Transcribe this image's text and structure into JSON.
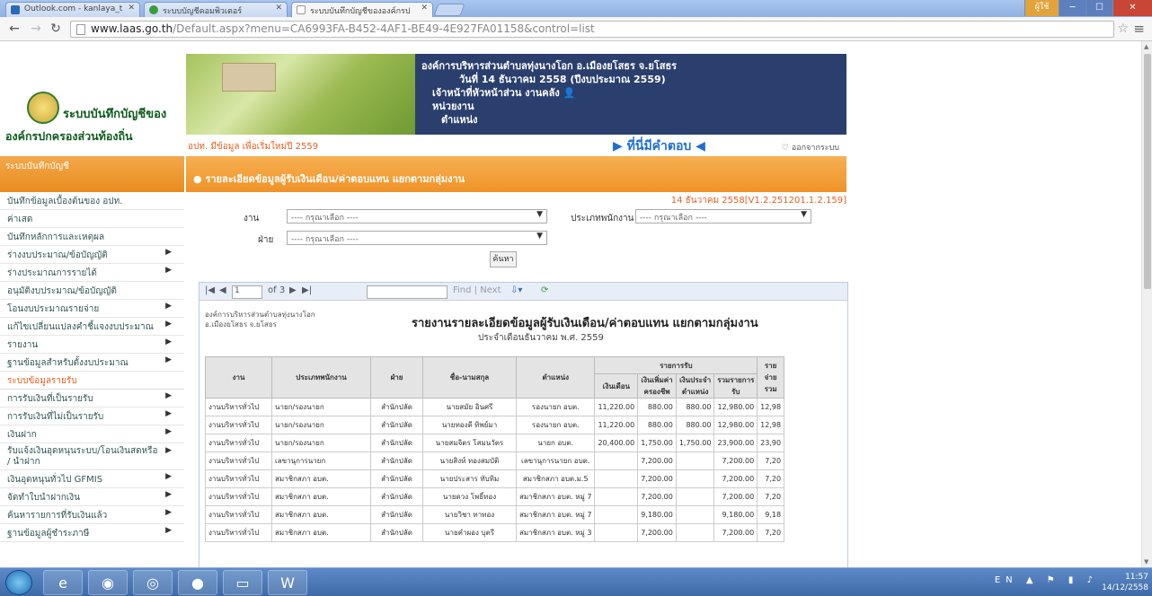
{
  "browser": {
    "tabs": [
      {
        "label": "Outlook.com - kanlaya_t",
        "favicon_color": "#2a6ab8"
      },
      {
        "label": "ระบบบัญชีคอมพิวเตอร์",
        "favicon_color": "#3c9c3c"
      },
      {
        "label": "ระบบบันทึกบัญชีขององค์กรป",
        "favicon_color": "#cccccc"
      }
    ],
    "url_domain": "www.laas.go.th",
    "url_path": "/Default.aspx?menu=CA6993FA-B452-4AF1-BE49-4E927FA01158&control=list",
    "user_button": "ผู้ใช้",
    "minimize": "─",
    "maximize": "☐",
    "close": "✕"
  },
  "site": {
    "logo_line1": "ระบบบันทึกบัญชีของ",
    "logo_line2": "องค์กรปกครองส่วนท้องถิ่น",
    "banner_lines": [
      "องค์การบริหารส่วนตำบลทุ่งนางโอก อ.เมืองยโสธร จ.ยโสธร",
      "วันที่ 14 ธันวาคม 2558 (ปีงบประมาณ 2559)",
      "เจ้าหน้าที่หัวหน้าส่วน งานคลัง",
      "หน่วยงาน",
      "ตำแหน่ง"
    ],
    "subline_left": "อปท. มีข้อมูล เพื่อเริ่มใหม่ปี 2559",
    "subline_center": "▶ ที่นี่มีคำตอบ ◀",
    "logout": "ออกจากระบบ"
  },
  "sidebar": {
    "header": "ระบบบันทึกบัญชี",
    "items": [
      {
        "label": "บันทึกข้อมูลเบื้องต้นของ อปท.",
        "arrow": ""
      },
      {
        "label": "ค่าเสด",
        "arrow": ""
      },
      {
        "label": "บันทึกหลักการและเหตุผล",
        "arrow": ""
      },
      {
        "label": "ร่างงบประมาณ/ข้อบัญญัติ",
        "arrow": "▶"
      },
      {
        "label": "ร่างประมาณการรายได้",
        "arrow": "▶"
      },
      {
        "label": "อนุมัติงบประมาณ/ข้อบัญญัติ",
        "arrow": ""
      },
      {
        "label": "โอนงบประมาณรายจ่าย",
        "arrow": "▶"
      },
      {
        "label": "แก้ไขเปลี่ยนแปลงคำชี้แจงงบประมาณ",
        "arrow": "▶"
      },
      {
        "label": "รายงาน",
        "arrow": "▶"
      },
      {
        "label": "ฐานข้อมูลสำหรับตั้งงบประมาณ",
        "arrow": "▶"
      }
    ],
    "section": "ระบบข้อมูลรายรับ",
    "items2": [
      {
        "label": "การรับเงินที่เป็นรายรับ",
        "arrow": "▶"
      },
      {
        "label": "การรับเงินที่ไม่เป็นรายรับ",
        "arrow": "▶"
      },
      {
        "label": "เงินฝาก",
        "arrow": "▶"
      },
      {
        "label": "รับแจ้งเงินอุดหนุนระบบ/โอนเงินสดหรือ / นำฝาก",
        "arrow": "▶"
      },
      {
        "label": "เงินอุดหนุนทั่วไป GFMIS",
        "arrow": "▶"
      },
      {
        "label": "จัดทำใบนำฝากเงิน",
        "arrow": "▶"
      },
      {
        "label": "ค้นหารายการที่รับเงินแล้ว",
        "arrow": "▶"
      },
      {
        "label": "ฐานข้อมูลผู้ชำระภาษี",
        "arrow": "▶"
      }
    ]
  },
  "content": {
    "header": "รายละเอียดข้อมูลผู้รับเงินเดือน/ค่าตอบแทน แยกตามกลุ่มงาน",
    "version": "14 ธันวาคม 2558[V1.2.251201.1.2.159]",
    "filter_job_label": "งาน",
    "filter_job_value": "---- กรุณาเลือก ----",
    "filter_type_label": "ประเภทพนักงาน",
    "filter_type_value": "---- กรุณาเลือก ----",
    "filter_div_label": "ฝ่าย",
    "filter_div_value": "---- กรุณาเลือก ----",
    "search_btn": "ค้นหา"
  },
  "report": {
    "page_current": "1",
    "page_total": "of 3",
    "find_label": "Find | Next",
    "org": [
      "องค์การบริหารส่วนตำบลทุ่งนางโอก",
      "อ.เมืองยโสธร จ.ยโสธร"
    ],
    "title": "รายงานรายละเอียดข้อมูลผู้รับเงินเดือน/ค่าตอบแทน แยกตามกลุ่มงาน",
    "subtitle": "ประจำเดือนธันวาคม พ.ศ. 2559",
    "columns": [
      "งาน",
      "ประเภทพนักงาน",
      "ฝ่าย",
      "ชื่อ-นามสกุล",
      "ตำแหน่ง"
    ],
    "income_group": "รายการรับ",
    "income_cols": [
      "เงินเดือน",
      "เงินเพิ่มค่าครองชีพ",
      "เงินประจำตำแหน่ง",
      "รวมรายการรับ"
    ],
    "last_col": "รายจ่ายรวม",
    "rows": [
      {
        "job": "งานบริหารทั่วไป",
        "type": "นายก/รองนายก",
        "div": "สำนักปลัด",
        "name": "นายสมัย อินศรี",
        "pos": "รองนายก อบต.",
        "c1": "11,220.00",
        "c2": "880.00",
        "c3": "880.00",
        "c4": "12,980.00",
        "c5": "12,98"
      },
      {
        "job": "งานบริหารทั่วไป",
        "type": "นายก/รองนายก",
        "div": "สำนักปลัด",
        "name": "นายทองดี ทิพย์มา",
        "pos": "รองนายก อบต.",
        "c1": "11,220.00",
        "c2": "880.00",
        "c3": "880.00",
        "c4": "12,980.00",
        "c5": "12,98"
      },
      {
        "job": "งานบริหารทั่วไป",
        "type": "นายก/รองนายก",
        "div": "สำนักปลัด",
        "name": "นายสมจิตร โสมนวัตร",
        "pos": "นายก อบต.",
        "c1": "20,400.00",
        "c2": "1,750.00",
        "c3": "1,750.00",
        "c4": "23,900.00",
        "c5": "23,90"
      },
      {
        "job": "งานบริหารทั่วไป",
        "type": "เลขานุการนายก",
        "div": "สำนักปลัด",
        "name": "นายสิงห์ ทองสมบัติ",
        "pos": "เลขานุการนายก อบต.",
        "c1": "",
        "c2": "7,200.00",
        "c3": "",
        "c4": "7,200.00",
        "c5": "7,20"
      },
      {
        "job": "งานบริหารทั่วไป",
        "type": "สมาชิกสภา อบต.",
        "div": "สำนักปลัด",
        "name": "นายประสาร ทับทิม",
        "pos": "สมาชิกสภา อบต.ม.5",
        "c1": "",
        "c2": "7,200.00",
        "c3": "",
        "c4": "7,200.00",
        "c5": "7,20"
      },
      {
        "job": "งานบริหารทั่วไป",
        "type": "สมาชิกสภา อบต.",
        "div": "สำนักปลัด",
        "name": "นายดวง โพธิ์ทอง",
        "pos": "สมาชิกสภา อบต. หมู่ 7",
        "c1": "",
        "c2": "7,200.00",
        "c3": "",
        "c4": "7,200.00",
        "c5": "7,20"
      },
      {
        "job": "งานบริหารทั่วไป",
        "type": "สมาชิกสภา อบต.",
        "div": "สำนักปลัด",
        "name": "นายวิชา ทาทอง",
        "pos": "สมาชิกสภา อบต. หมู่ 7",
        "c1": "",
        "c2": "9,180.00",
        "c3": "",
        "c4": "9,180.00",
        "c5": "9,18"
      },
      {
        "job": "งานบริหารทั่วไป",
        "type": "สมาชิกสภา อบต.",
        "div": "สำนักปลัด",
        "name": "นายคำผอง บุตรี",
        "pos": "สมาชิกสภา อบต. หมู่ 3",
        "c1": "",
        "c2": "7,200.00",
        "c3": "",
        "c4": "7,200.00",
        "c5": "7,20"
      }
    ]
  },
  "taskbar": {
    "lang": "EN",
    "time": "11:57",
    "date": "14/12/2558"
  }
}
